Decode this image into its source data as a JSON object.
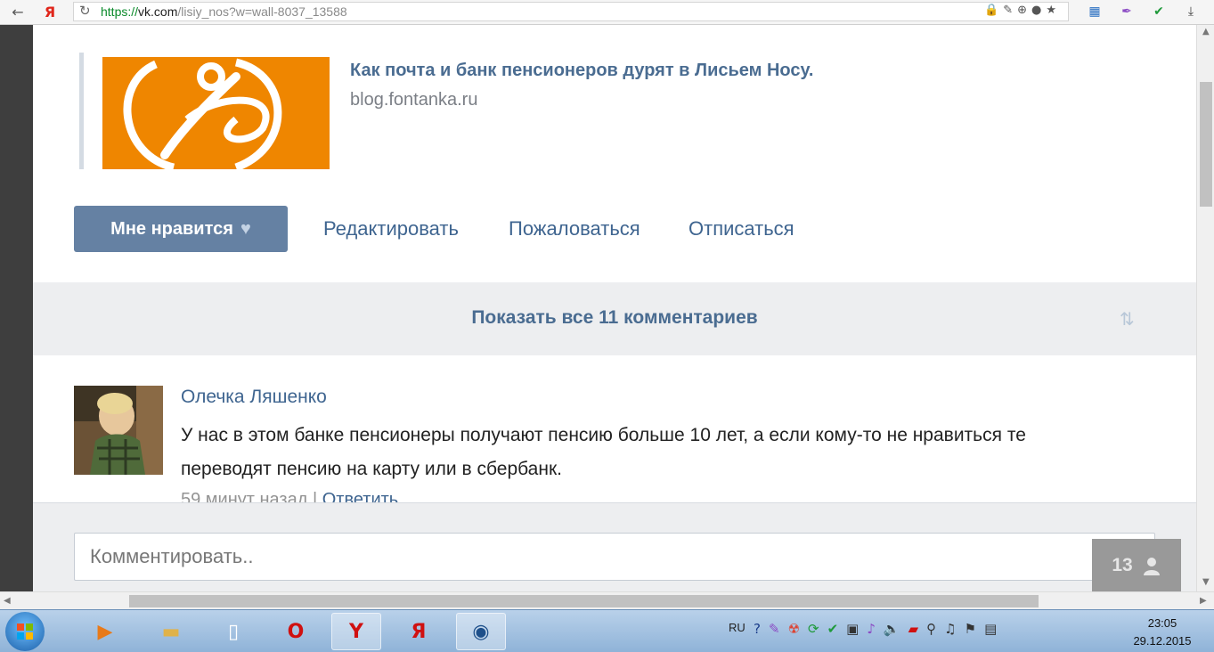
{
  "browser": {
    "url_scheme": "https://",
    "url_host": "vk.com",
    "url_path": "/lisiy_nos?w=wall-8037_13588",
    "back_glyph": "←",
    "yandex_glyph": "Я",
    "reload_glyph": "↻"
  },
  "post": {
    "link_title": "Как почта и банк пенсионеров дурят в Лисьем Носу.",
    "link_domain": "blog.fontanka.ru",
    "like_label": "Мне нравится",
    "heart_glyph": "♥",
    "actions": [
      "Редактировать",
      "Пожаловаться",
      "Отписаться"
    ]
  },
  "comments": {
    "show_all_label": "Показать все 11 комментариев",
    "sort_glyph": "⇅",
    "items": [
      {
        "author": "Олечка Ляшенко",
        "text": "У нас в этом банке пенсионеры получают пенсию больше 10 лет, а если кому-то не нравиться те переводят пенсию на карту или в сбербанк.",
        "time": "59 минут назад",
        "separator": "|",
        "reply": "Ответить"
      }
    ],
    "composer_placeholder": "Комментировать..",
    "viewers_count": "13"
  },
  "taskbar": {
    "language": "RU",
    "time": "23:05",
    "date": "29.12.2015"
  },
  "colors": {
    "accent": "#4a6c91",
    "like_button": "#6581a3",
    "link_thumbnail": "#ef8600"
  }
}
